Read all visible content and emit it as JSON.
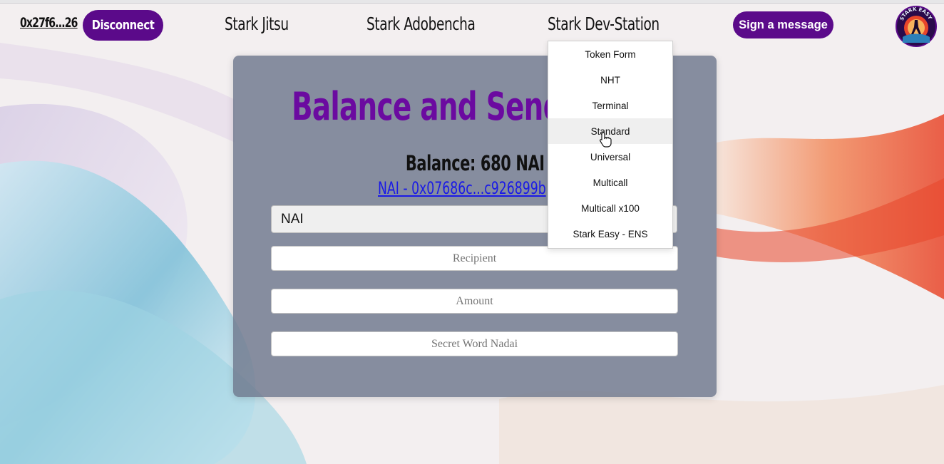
{
  "nav": {
    "address": "0x27f6...26",
    "disconnect_label": "Disconnect",
    "links": [
      "Stark Jitsu",
      "Stark Adobencha",
      "Stark Dev-Station"
    ],
    "sign_label": "Sign a message",
    "logo_text": "STARK EASY"
  },
  "dropdown": {
    "items": [
      "Token Form",
      "NHT",
      "Terminal",
      "Standard",
      "Universal",
      "Multicall",
      "Multicall x100",
      "Stark Easy - ENS"
    ],
    "hovered": "Standard"
  },
  "card": {
    "title": "Balance and Send th",
    "balance": "Balance: 680 NAI",
    "token_link": "NAI - 0x07686c...c926899b",
    "token_select": "NAI",
    "recipient_placeholder": "Recipient",
    "amount_placeholder": "Amount",
    "secret_placeholder": "Secret Word Nadai"
  },
  "colors": {
    "accent": "#5b0a8a",
    "title": "#6b0aa0",
    "link": "#1a1ae6",
    "card": "#6e788c"
  }
}
